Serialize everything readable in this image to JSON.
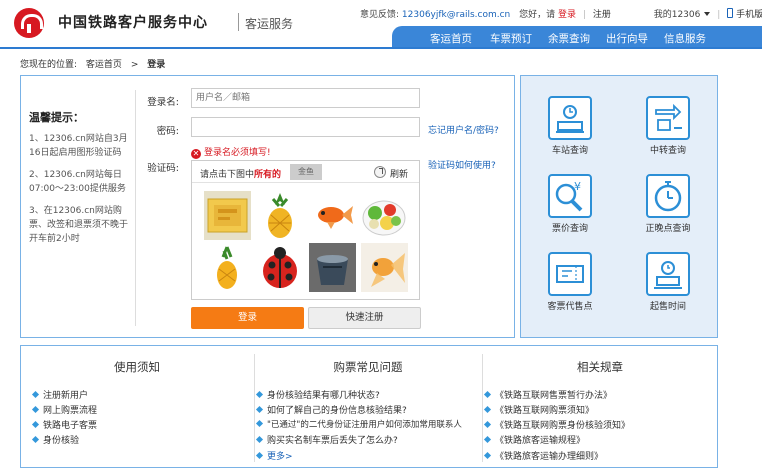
{
  "header": {
    "site_name": "中国铁路客户服务中心",
    "site_sub": "客运服务",
    "feedback_label": "意见反馈:",
    "feedback_email": "12306yjfk@rails.com.cn",
    "greeting": "您好，请",
    "login_link": "登录",
    "register_link": "注册",
    "my_12306": "我的12306",
    "mobile": "手机版"
  },
  "nav": {
    "items": [
      "客运首页",
      "车票预订",
      "余票查询",
      "出行向导",
      "信息服务"
    ]
  },
  "breadcrumb": {
    "prefix": "您现在的位置:",
    "home": "客运首页",
    "arrow": ">",
    "current": "登录"
  },
  "tips": {
    "title": "温馨提示：",
    "items": [
      "1、12306.cn网站自3月16日起启用图形验证码",
      "2、12306.cn网站每日07:00～23:00提供服务",
      "3、在12306.cn网站购票、改签和退票须不晚于开车前2小时"
    ]
  },
  "form": {
    "username_label": "登录名:",
    "username_placeholder": "用户名／邮箱",
    "password_label": "密码:",
    "forgot_link": "忘记用户名/密码?",
    "error_text": "登录名必须填写!",
    "captcha_label": "验证码:",
    "captcha_help_link": "验证码如何使用?",
    "captcha_prompt_before": "请点击下图中",
    "captcha_prompt_red": "所有的",
    "captcha_word": "金鱼",
    "refresh_label": "刷新",
    "login_button": "登录",
    "register_button": "快速注册"
  },
  "services": [
    {
      "label": "车站查询",
      "icon": "station-icon"
    },
    {
      "label": "中转查询",
      "icon": "transfer-icon"
    },
    {
      "label": "票价查询",
      "icon": "price-search-icon"
    },
    {
      "label": "正晚点查询",
      "icon": "stopwatch-icon"
    },
    {
      "label": "客票代售点",
      "icon": "ticket-agent-icon"
    },
    {
      "label": "起售时间",
      "icon": "sale-time-icon"
    }
  ],
  "bottom": {
    "columns": [
      {
        "title": "使用须知",
        "items": [
          "注册新用户",
          "网上购票流程",
          "铁路电子客票",
          "身份核验"
        ]
      },
      {
        "title": "购票常见问题",
        "items": [
          "身份核验结果有哪几种状态?",
          "如何了解自己的身份信息核验结果?",
          "\"已通过\"的二代身份证注册用户如何添加常用联系人",
          "购买实名制车票后丢失了怎么办?"
        ],
        "more": "更多>"
      },
      {
        "title": "相关规章",
        "items": [
          "《铁路互联网售票暂行办法》",
          "《铁路互联网购票须知》",
          "《铁路互联网购票身份核验须知》",
          "《铁路旅客运输规程》",
          "《铁路旅客运输办理细则》"
        ]
      }
    ]
  },
  "colors": {
    "brand_red": "#d71921",
    "nav_blue": "#3a86d8",
    "border_blue": "#79b2e6",
    "login_orange": "#f57b14",
    "services_bg": "#e4eef9"
  }
}
